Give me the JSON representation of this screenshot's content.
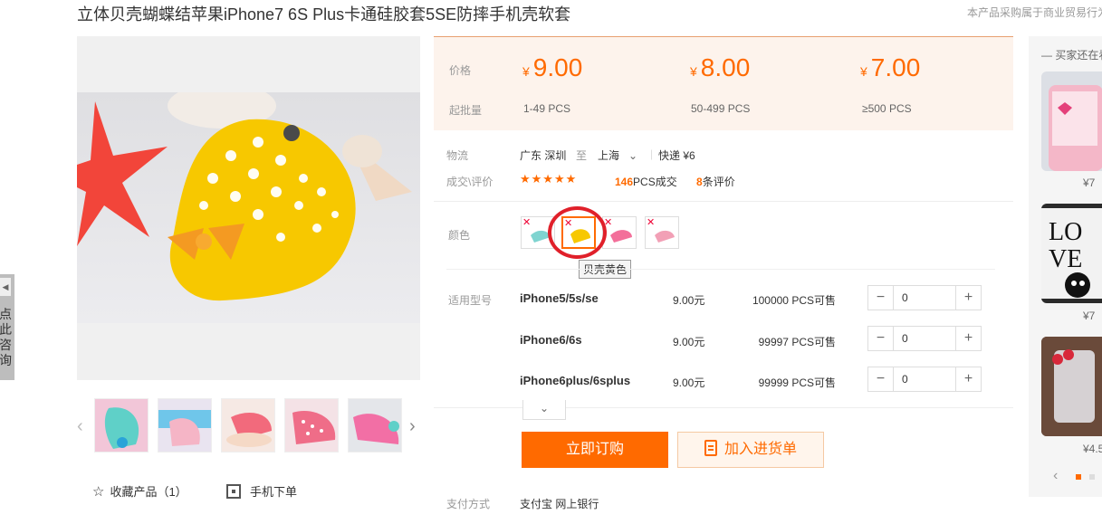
{
  "product": {
    "title": "立体贝壳蝴蝶结苹果iPhone7 6S Plus卡通硅胶套5SE防摔手机壳软套",
    "notice": "本产品采购属于商业贸易行为"
  },
  "float_tab": {
    "label": "点此咨询",
    "arrow": "◀"
  },
  "gallery": {
    "fav_label": "收藏产品（1）",
    "mobile_label": "手机下单",
    "prev_arrow": "‹",
    "next_arrow": "›"
  },
  "price_box": {
    "price_label": "价格",
    "moq_label": "起批量",
    "currency": "¥",
    "tiers": [
      {
        "price": "9.00",
        "range": "1-49  PCS"
      },
      {
        "price": "8.00",
        "range": "50-499  PCS"
      },
      {
        "price": "7.00",
        "range": "≥500  PCS"
      }
    ]
  },
  "logistics": {
    "label": "物流",
    "from": "广东  深圳",
    "to_word": "至",
    "to_city": "上海",
    "express": "快递  ¥6"
  },
  "deals": {
    "label": "成交\\评价",
    "stars": "★★★★★",
    "sold_count": "146",
    "sold_suffix": "PCS成交",
    "review_count": "8",
    "review_suffix": "条评价"
  },
  "color": {
    "label": "颜色",
    "tooltip": "贝壳黄色",
    "options": [
      "blue",
      "yellow",
      "pink",
      "pink-light"
    ]
  },
  "models": {
    "label": "适用型号",
    "rows": [
      {
        "name": "iPhone5/5s/se",
        "price": "9.00元",
        "stock": "100000 PCS可售",
        "qty": "0"
      },
      {
        "name": "iPhone6/6s",
        "price": "9.00元",
        "stock": "99997 PCS可售",
        "qty": "0"
      },
      {
        "name": "iPhone6plus/6splus",
        "price": "9.00元",
        "stock": "99999 PCS可售",
        "qty": "0"
      }
    ],
    "minus": "−",
    "plus": "+",
    "expand": "⌄"
  },
  "actions": {
    "buy_now": "立即订购",
    "add_cart": "加入进货单"
  },
  "payment": {
    "label": "支付方式",
    "methods": "支付宝   网上银行"
  },
  "rail": {
    "title": "— 买家还在看",
    "prices": [
      "¥7",
      "¥7",
      "¥4.5"
    ],
    "prev": "‹"
  },
  "colors": {
    "accent": "#ff6a00",
    "price_bg": "#fdf3ec",
    "highlight_circle": "#e0202a"
  }
}
